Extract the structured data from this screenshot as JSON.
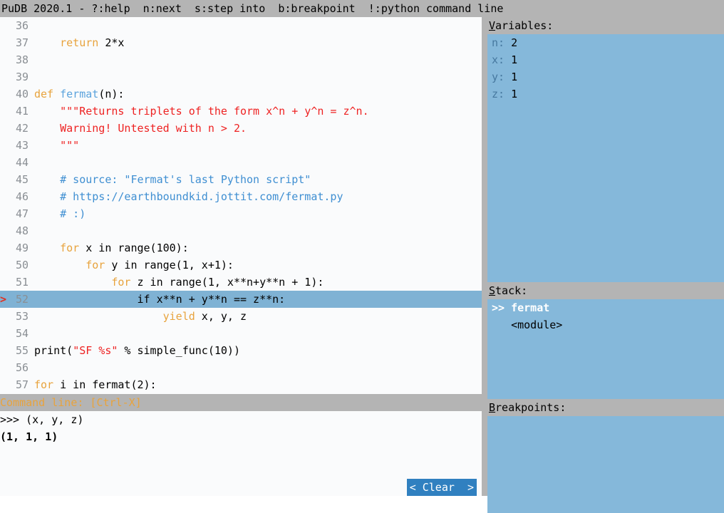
{
  "titlebar": {
    "text": "PuDB 2020.1 - ?:help  n:next  s:step into  b:breakpoint  !:python command line"
  },
  "colors": {
    "titlebar_bg": "#b4b4b4",
    "code_bg": "#fafbfc",
    "current_line_bg": "#7fb2d4",
    "sidebar_bg": "#85b8da",
    "section_header_bg": "#b4b4b4",
    "keyword": "#e8a33d",
    "function": "#5ba3dd",
    "string": "#ee2222",
    "comment": "#3f8fd2",
    "lineno": "#8a8f94",
    "marker": "#e03020",
    "button_bg": "#3080c0",
    "varname": "#46789f"
  },
  "code": {
    "current_line": 52,
    "marker_glyph": ">",
    "lines": [
      {
        "num": "36",
        "tokens": []
      },
      {
        "num": "37",
        "tokens": [
          {
            "t": "    ",
            "c": "plain"
          },
          {
            "t": "return",
            "c": "kw"
          },
          {
            "t": " 2*x",
            "c": "plain"
          }
        ]
      },
      {
        "num": "38",
        "tokens": []
      },
      {
        "num": "39",
        "tokens": []
      },
      {
        "num": "40",
        "tokens": [
          {
            "t": "def",
            "c": "kw"
          },
          {
            "t": " ",
            "c": "plain"
          },
          {
            "t": "fermat",
            "c": "fn"
          },
          {
            "t": "(n):",
            "c": "plain"
          }
        ]
      },
      {
        "num": "41",
        "tokens": [
          {
            "t": "    ",
            "c": "plain"
          },
          {
            "t": "\"\"\"Returns triplets of the form x^n + y^n = z^n.",
            "c": "str"
          }
        ]
      },
      {
        "num": "42",
        "tokens": [
          {
            "t": "    ",
            "c": "plain"
          },
          {
            "t": "Warning! Untested with n > 2.",
            "c": "str"
          }
        ]
      },
      {
        "num": "43",
        "tokens": [
          {
            "t": "    ",
            "c": "plain"
          },
          {
            "t": "\"\"\"",
            "c": "str"
          }
        ]
      },
      {
        "num": "44",
        "tokens": []
      },
      {
        "num": "45",
        "tokens": [
          {
            "t": "    ",
            "c": "plain"
          },
          {
            "t": "# source: \"Fermat's last Python script\"",
            "c": "comment"
          }
        ]
      },
      {
        "num": "46",
        "tokens": [
          {
            "t": "    ",
            "c": "plain"
          },
          {
            "t": "# https://earthboundkid.jottit.com/fermat.py",
            "c": "comment"
          }
        ]
      },
      {
        "num": "47",
        "tokens": [
          {
            "t": "    ",
            "c": "plain"
          },
          {
            "t": "# :)",
            "c": "comment"
          }
        ]
      },
      {
        "num": "48",
        "tokens": []
      },
      {
        "num": "49",
        "tokens": [
          {
            "t": "    ",
            "c": "plain"
          },
          {
            "t": "for",
            "c": "kw"
          },
          {
            "t": " x in range(100):",
            "c": "plain"
          }
        ]
      },
      {
        "num": "50",
        "tokens": [
          {
            "t": "        ",
            "c": "plain"
          },
          {
            "t": "for",
            "c": "kw"
          },
          {
            "t": " y in range(1, x+1):",
            "c": "plain"
          }
        ]
      },
      {
        "num": "51",
        "tokens": [
          {
            "t": "            ",
            "c": "plain"
          },
          {
            "t": "for",
            "c": "kw"
          },
          {
            "t": " z in range(1, x**n+y**n + 1):",
            "c": "plain"
          }
        ]
      },
      {
        "num": "52",
        "current": true,
        "tokens": [
          {
            "t": "                if x**n + y**n == z**n:",
            "c": "plain"
          }
        ]
      },
      {
        "num": "53",
        "tokens": [
          {
            "t": "                    ",
            "c": "plain"
          },
          {
            "t": "yield",
            "c": "kw"
          },
          {
            "t": " x, y, z",
            "c": "plain"
          }
        ]
      },
      {
        "num": "54",
        "tokens": []
      },
      {
        "num": "55",
        "tokens": [
          {
            "t": "print(",
            "c": "plain"
          },
          {
            "t": "\"SF %s\"",
            "c": "str"
          },
          {
            "t": " % simple_func(10))",
            "c": "plain"
          }
        ]
      },
      {
        "num": "56",
        "tokens": []
      },
      {
        "num": "57",
        "tokens": [
          {
            "t": "for",
            "c": "kw"
          },
          {
            "t": " i in fermat(2):",
            "c": "plain"
          }
        ]
      }
    ]
  },
  "command_line": {
    "header": "Command line: [Ctrl-X]",
    "history": [
      {
        "text": ">>> (x, y, z)",
        "kind": "input"
      },
      {
        "text": "(1, 1, 1)",
        "kind": "result"
      }
    ],
    "prompt": ">>> ",
    "input_value": "",
    "clear_button": "< Clear  >"
  },
  "sidebar": {
    "variables": {
      "header_hotkey": "V",
      "header_rest": "ariables:",
      "items": [
        {
          "name": "n:",
          "value": " 2"
        },
        {
          "name": "x:",
          "value": " 1"
        },
        {
          "name": "y:",
          "value": " 1"
        },
        {
          "name": "z:",
          "value": " 1"
        }
      ]
    },
    "stack": {
      "header_hotkey": "S",
      "header_rest": "tack:",
      "items": [
        {
          "marker": ">>",
          "label": "fermat",
          "current": true
        },
        {
          "marker": "  ",
          "label": "<module>",
          "current": false
        }
      ]
    },
    "breakpoints": {
      "header_hotkey": "B",
      "header_rest": "reakpoints:",
      "items": []
    }
  }
}
